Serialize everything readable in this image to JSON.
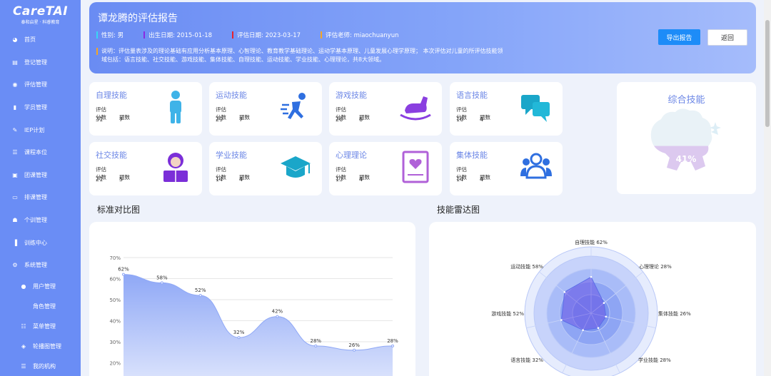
{
  "sidebar": {
    "brand": "CareTAI",
    "brand_sub": "泰和启星 · 科睿教育",
    "items": [
      {
        "label": "首页",
        "icon": "dashboard-icon"
      },
      {
        "label": "登记管理",
        "icon": "register-icon"
      },
      {
        "label": "评估管理",
        "icon": "eval-icon"
      },
      {
        "label": "学员管理",
        "icon": "student-icon"
      },
      {
        "label": "IEP计划",
        "icon": "edit-icon"
      },
      {
        "label": "课程本位",
        "icon": "list-icon"
      },
      {
        "label": "团课管理",
        "icon": "group-class-icon"
      },
      {
        "label": "排课管理",
        "icon": "schedule-icon"
      },
      {
        "label": "个训管理",
        "icon": "person-train-icon"
      },
      {
        "label": "训练中心",
        "icon": "chart-bar-icon"
      },
      {
        "label": "系统管理",
        "icon": "gear-icon"
      }
    ],
    "sub_items": [
      {
        "label": "用户管理",
        "icon": "user-icon"
      },
      {
        "label": "角色管理",
        "icon": ""
      },
      {
        "label": "菜单管理",
        "icon": "menu-tree-icon"
      },
      {
        "label": "轮播图管理",
        "icon": "layers-icon"
      },
      {
        "label": "我的机构",
        "icon": "org-icon"
      }
    ]
  },
  "header": {
    "title": "谭龙腾的评估报告",
    "gender": "性别:   男",
    "birth": "出生日期:   2015-01-18",
    "eval_date": "评估日期:   2023-03-17",
    "teacher": "评估老师:   miaochuanyun",
    "desc": "说明：评估量表涉及的理论基础有应用分析基本原理、心智理论、教育教学基础理论、运动学基本原理、儿童发展心理学原理；  本次评估对儿童的所评估技能领域包括：语言技能、社交技能、游戏技能、集体技能、自理技能、运动技能、学业技能、心理理论，共8大领域。",
    "export_label": "导出报告",
    "back_label": "返回",
    "colors": {
      "gender": "#38d6f5",
      "birth": "#8a2be2",
      "eval": "#e8222b",
      "teacher": "#f5a623"
    }
  },
  "col_label_score": "评估分数",
  "col_label_count": "题数",
  "skills": [
    {
      "name": "自理技能",
      "score": "31",
      "count": "7",
      "icon": "child-standing-icon"
    },
    {
      "name": "运动技能",
      "score": "29",
      "count": "7",
      "icon": "running-icon"
    },
    {
      "name": "游戏技能",
      "score": "26",
      "count": "6",
      "icon": "rocking-horse-icon"
    },
    {
      "name": "语言技能",
      "score": "16",
      "count": "4",
      "icon": "chat-bubbles-icon"
    },
    {
      "name": "社交技能",
      "score": "21",
      "count": "5",
      "icon": "reading-child-icon"
    },
    {
      "name": "学业技能",
      "score": "14",
      "count": "4",
      "icon": "graduation-cap-icon"
    },
    {
      "name": "心理理论",
      "score": "13",
      "count": "4",
      "icon": "heart-card-icon"
    },
    {
      "name": "集体技能",
      "score": "14",
      "count": "4",
      "icon": "group-people-icon"
    }
  ],
  "total": {
    "title": "综合技能",
    "percent": "41%",
    "value": 41
  },
  "sections": {
    "compare": "标准对比图",
    "radar": "技能雷达图"
  },
  "chart_data": [
    {
      "type": "area",
      "title": "标准对比图",
      "y_ticks": [
        "70%",
        "60%",
        "50%",
        "40%",
        "30%",
        "20%"
      ],
      "ylim": [
        20,
        70
      ],
      "values": [
        62,
        58,
        52,
        32,
        42,
        28,
        26,
        28
      ],
      "value_labels": [
        "62%",
        "58%",
        "52%",
        "32%",
        "42%",
        "28%",
        "26%",
        "28%"
      ],
      "grid": true
    },
    {
      "type": "radar",
      "title": "技能雷达图",
      "axes": [
        "自理技能",
        "心理理论",
        "集体技能",
        "学业技能",
        "语言技能",
        "游戏技能",
        "运动技能"
      ],
      "axis_labels": [
        "自理技能 62%",
        "心理理论 28%",
        "集体技能 26%",
        "学业技能 28%",
        "语言技能 32%",
        "游戏技能 52%",
        "运动技能 58%"
      ],
      "values": [
        62,
        28,
        26,
        28,
        32,
        52,
        58
      ],
      "max": 100
    }
  ]
}
